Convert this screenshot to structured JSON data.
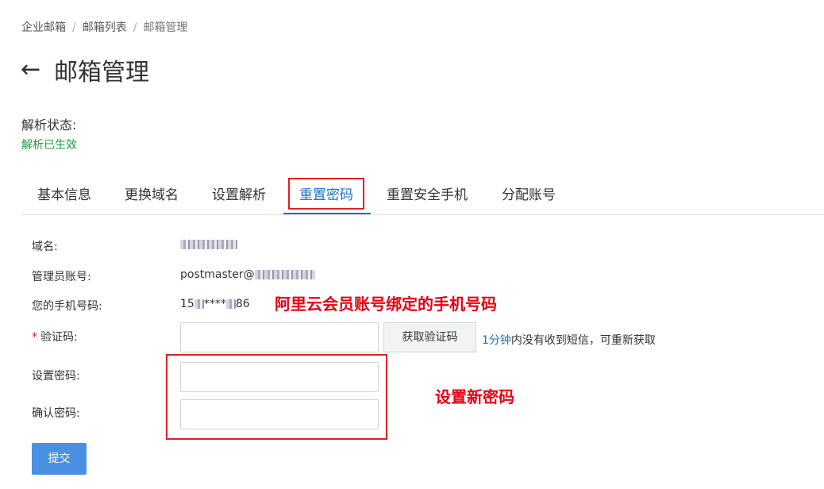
{
  "breadcrumb": [
    "企业邮箱",
    "邮箱列表",
    "邮箱管理"
  ],
  "header": {
    "back_icon": "←",
    "title": "邮箱管理"
  },
  "resolve": {
    "label": "解析状态:",
    "status": "解析已生效",
    "status_color": "#1e9e3a"
  },
  "tabs": [
    {
      "label": "基本信息"
    },
    {
      "label": "更换域名"
    },
    {
      "label": "设置解析"
    },
    {
      "label": "重置密码",
      "active": true
    },
    {
      "label": "重置安全手机"
    },
    {
      "label": "分配账号"
    }
  ],
  "form": {
    "domain": {
      "label": "域名:"
    },
    "admin": {
      "label": "管理员账号:",
      "value_prefix": "postmaster@"
    },
    "phone": {
      "label": "您的手机号码:",
      "value_prefix": "15",
      "value_mid": "****",
      "value_suffix": "86"
    },
    "code": {
      "required_mark": "*",
      "label": "验证码:",
      "placeholder": ""
    },
    "get_code_label": "获取验证码",
    "hint": {
      "countdown": "1分钟",
      "text": "内没有收到短信，可重新获取"
    },
    "new_password": {
      "label": "设置密码:",
      "placeholder": ""
    },
    "confirm_password": {
      "label": "确认密码:",
      "placeholder": ""
    },
    "submit_label": "提交"
  },
  "annotations": {
    "phone_note": "阿里云会员账号绑定的手机号码",
    "password_note": "设置新密码",
    "color": "#e60012"
  },
  "colors": {
    "accent": "#1a73c8",
    "primary_button": "#4a90e2",
    "highlight_box": "#e02020"
  }
}
